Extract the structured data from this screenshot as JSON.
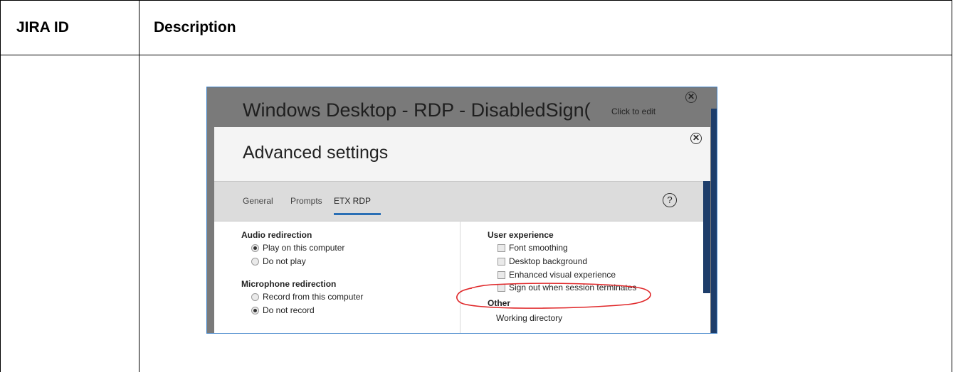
{
  "table": {
    "col1_header": "JIRA ID",
    "col2_header": "Description"
  },
  "screenshot": {
    "window_title": "Windows Desktop - RDP - DisabledSign(",
    "click_to_edit": "Click to edit",
    "modal_title": "Advanced settings",
    "tabs": [
      {
        "label": "General",
        "active": false
      },
      {
        "label": "Prompts",
        "active": false
      },
      {
        "label": "ETX RDP",
        "active": true
      }
    ],
    "help_label": "?",
    "close_glyph": "✕",
    "left_sections": {
      "audio_title": "Audio redirection",
      "audio_options": [
        {
          "label": "Play on this computer",
          "selected": true
        },
        {
          "label": "Do not play",
          "selected": false
        }
      ],
      "mic_title": "Microphone redirection",
      "mic_options": [
        {
          "label": "Record from this computer",
          "selected": false
        },
        {
          "label": "Do not record",
          "selected": true
        }
      ]
    },
    "right_sections": {
      "ux_title": "User experience",
      "ux_options": [
        {
          "label": "Font smoothing",
          "checked": false
        },
        {
          "label": "Desktop background",
          "checked": false
        },
        {
          "label": "Enhanced visual experience",
          "checked": false
        },
        {
          "label": "Sign out when session terminates",
          "checked": false
        }
      ],
      "other_title": "Other",
      "working_directory": "Working directory"
    },
    "annotation_color": "#e0282a"
  }
}
